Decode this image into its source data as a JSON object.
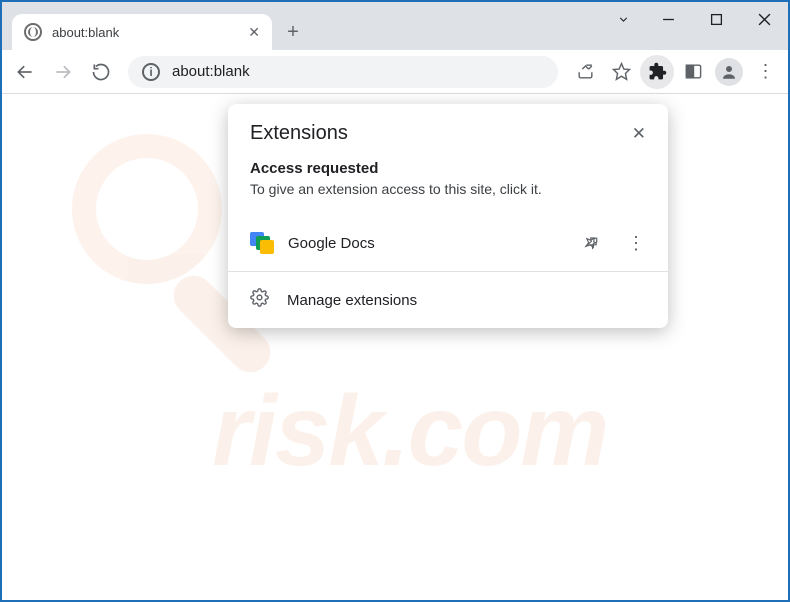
{
  "tab": {
    "title": "about:blank"
  },
  "omnibox": {
    "text": "about:blank"
  },
  "popup": {
    "title": "Extensions",
    "section_head": "Access requested",
    "section_desc": "To give an extension access to this site, click it.",
    "ext_name": "Google Docs",
    "manage_label": "Manage extensions"
  },
  "watermark": {
    "text": "risk.com"
  }
}
